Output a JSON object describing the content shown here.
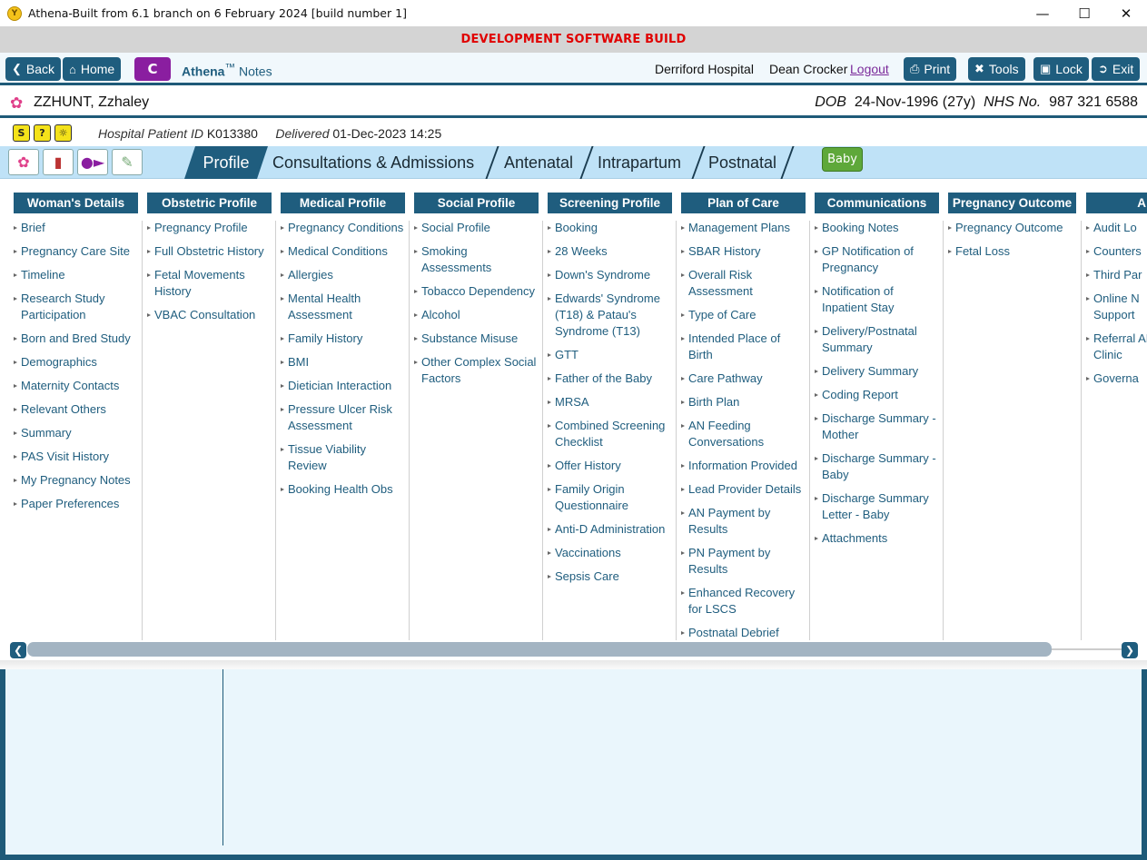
{
  "window": {
    "title": "Athena-Built from 6.1 branch on 6 February 2024 [build number 1]"
  },
  "dev_banner": "DEVELOPMENT SOFTWARE BUILD",
  "nav": {
    "back": "Back",
    "home": "Home",
    "c_label": "C",
    "app_name": "Athena",
    "app_tm": "™",
    "app_notes": "Notes",
    "hospital": "Derriford Hospital",
    "user": "Dean Crocker",
    "logout": "Logout",
    "print": "Print",
    "tools": "Tools",
    "lock": "Lock",
    "exit": "Exit"
  },
  "patient": {
    "name": "ZZHUNT, Zzhaley",
    "dob_label": "DOB",
    "dob": "24-Nov-1996 (27y)",
    "nhs_label": "NHS No.",
    "nhs": "987 321 6588",
    "hospital_id_label": "Hospital Patient ID",
    "hospital_id": "K013380",
    "delivered_label": "Delivered",
    "delivered": "01-Dec-2023 14:25"
  },
  "tabs": [
    "Profile",
    "Consultations & Admissions",
    "Antenatal",
    "Intrapartum",
    "Postnatal"
  ],
  "baby_button": "Baby",
  "columns": [
    {
      "title": "Woman's Details",
      "items": [
        "Brief",
        "Pregnancy Care Site",
        "Timeline",
        "Research Study Participation",
        "Born and Bred Study",
        "Demographics",
        "Maternity Contacts",
        "Relevant Others",
        "Summary",
        "PAS Visit History",
        "My Pregnancy Notes",
        "Paper Preferences"
      ]
    },
    {
      "title": "Obstetric Profile",
      "items": [
        "Pregnancy Profile",
        "Full Obstetric History",
        "Fetal Movements History",
        "VBAC Consultation"
      ]
    },
    {
      "title": "Medical Profile",
      "items": [
        "Pregnancy Conditions",
        "Medical Conditions",
        "Allergies",
        "Mental Health Assessment",
        "Family History",
        "BMI",
        "Dietician Interaction",
        "Pressure Ulcer Risk Assessment",
        "Tissue Viability Review",
        "Booking Health Obs"
      ]
    },
    {
      "title": "Social Profile",
      "items": [
        "Social Profile",
        "Smoking Assessments",
        "Tobacco Dependency",
        "Alcohol",
        "Substance Misuse",
        "Other Complex Social Factors"
      ]
    },
    {
      "title": "Screening Profile",
      "items": [
        "Booking",
        "28 Weeks",
        "Down's Syndrome",
        "Edwards' Syndrome (T18) & Patau's Syndrome (T13)",
        "GTT",
        "Father of the Baby",
        "MRSA",
        "Combined Screening Checklist",
        "Offer History",
        "Family Origin Questionnaire",
        "Anti-D Administration",
        "Vaccinations",
        "Sepsis Care"
      ]
    },
    {
      "title": "Plan of Care",
      "items": [
        "Management Plans",
        "SBAR History",
        "Overall Risk Assessment",
        "Type of Care",
        "Intended Place of Birth",
        "Care Pathway",
        "Birth Plan",
        "AN Feeding Conversations",
        "Information Provided",
        "Lead Provider Details",
        "AN Payment by Results",
        "PN Payment by Results",
        "Enhanced Recovery for LSCS",
        "Postnatal Debrief"
      ]
    },
    {
      "title": "Communications",
      "items": [
        "Booking Notes",
        "GP Notification of Pregnancy",
        "Notification of Inpatient Stay",
        "Delivery/Postnatal Summary",
        "Delivery Summary",
        "Coding Report",
        "Discharge Summary - Mother",
        "Discharge Summary - Baby",
        "Discharge Summary Letter - Baby",
        "Attachments"
      ]
    },
    {
      "title": "Pregnancy Outcome",
      "items": [
        "Pregnancy Outcome",
        "Fetal Loss"
      ]
    },
    {
      "title": "A",
      "items": [
        "Audit Lo",
        "Counters",
        "Third Par",
        "Online N Support",
        "Referral AN Clinic",
        "Governa"
      ]
    }
  ]
}
